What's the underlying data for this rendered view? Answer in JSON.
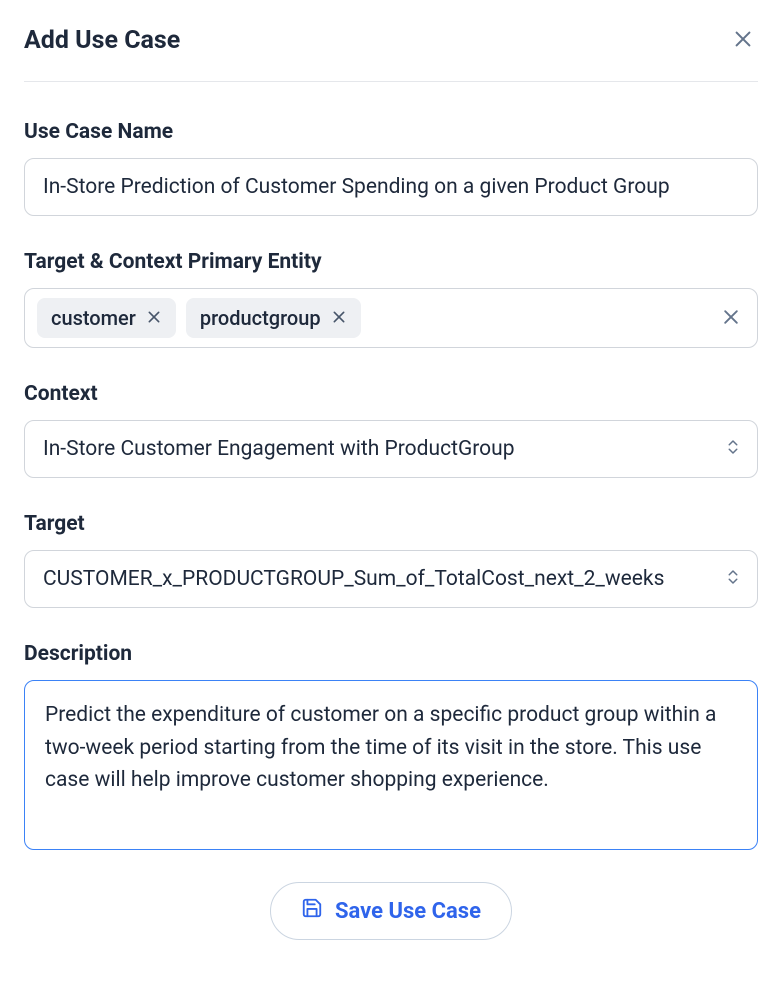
{
  "header": {
    "title": "Add Use Case"
  },
  "fields": {
    "useCaseName": {
      "label": "Use Case Name",
      "value": "In-Store Prediction of Customer Spending on a given Product Group"
    },
    "primaryEntity": {
      "label": "Target & Context Primary Entity",
      "tags": [
        "customer",
        "productgroup"
      ]
    },
    "context": {
      "label": "Context",
      "value": "In-Store Customer Engagement with ProductGroup"
    },
    "target": {
      "label": "Target",
      "value": "CUSTOMER_x_PRODUCTGROUP_Sum_of_TotalCost_next_2_weeks"
    },
    "description": {
      "label": "Description",
      "value": "Predict the expenditure of customer on a specific product group within a two-week period starting from the time of its visit in the store. This use case will help improve customer shopping experience."
    }
  },
  "buttons": {
    "save": "Save Use Case"
  }
}
